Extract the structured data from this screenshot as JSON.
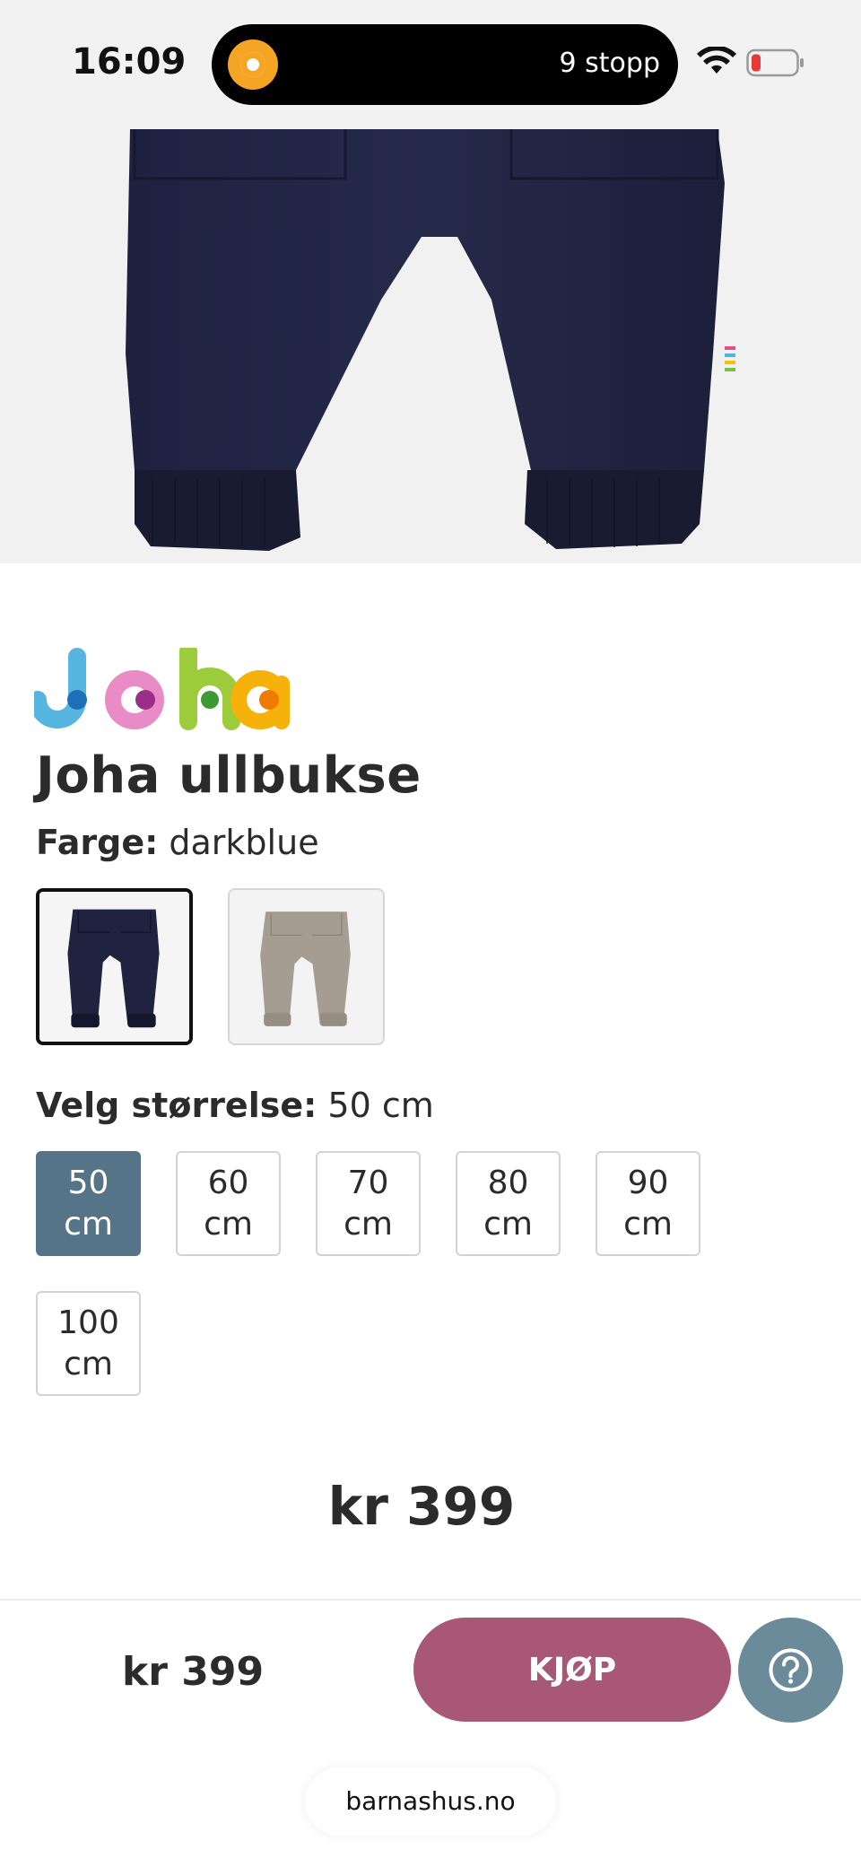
{
  "status_bar": {
    "time": "16:09",
    "live_activity_text": "9 stopp",
    "icons": [
      "activity-ring-icon",
      "wifi-icon",
      "battery-low-icon"
    ]
  },
  "product": {
    "title": "Joha ullbukse",
    "color_label": "Farge:",
    "color_value": "darkblue",
    "swatches": [
      {
        "name": "darkblue",
        "selected": true,
        "color": "#1f2340"
      },
      {
        "name": "beige",
        "selected": false,
        "color": "#a69d92"
      }
    ],
    "size_label": "Velg størrelse:",
    "size_value": "50 cm",
    "sizes": [
      {
        "num": "50",
        "unit": "cm",
        "selected": true
      },
      {
        "num": "60",
        "unit": "cm",
        "selected": false
      },
      {
        "num": "70",
        "unit": "cm",
        "selected": false
      },
      {
        "num": "80",
        "unit": "cm",
        "selected": false
      },
      {
        "num": "90",
        "unit": "cm",
        "selected": false
      },
      {
        "num": "100",
        "unit": "cm",
        "selected": false
      }
    ],
    "price": "kr 399"
  },
  "purchase_bar": {
    "price": "kr 399",
    "buy_label": "KJØP",
    "help_icon": "question-circle-icon"
  },
  "browser": {
    "url": "barnashus.no"
  },
  "colors": {
    "selected_size": "#567487",
    "buy_button": "#a85775",
    "help_button": "#6b8b9b",
    "text": "#2b2b2b"
  }
}
